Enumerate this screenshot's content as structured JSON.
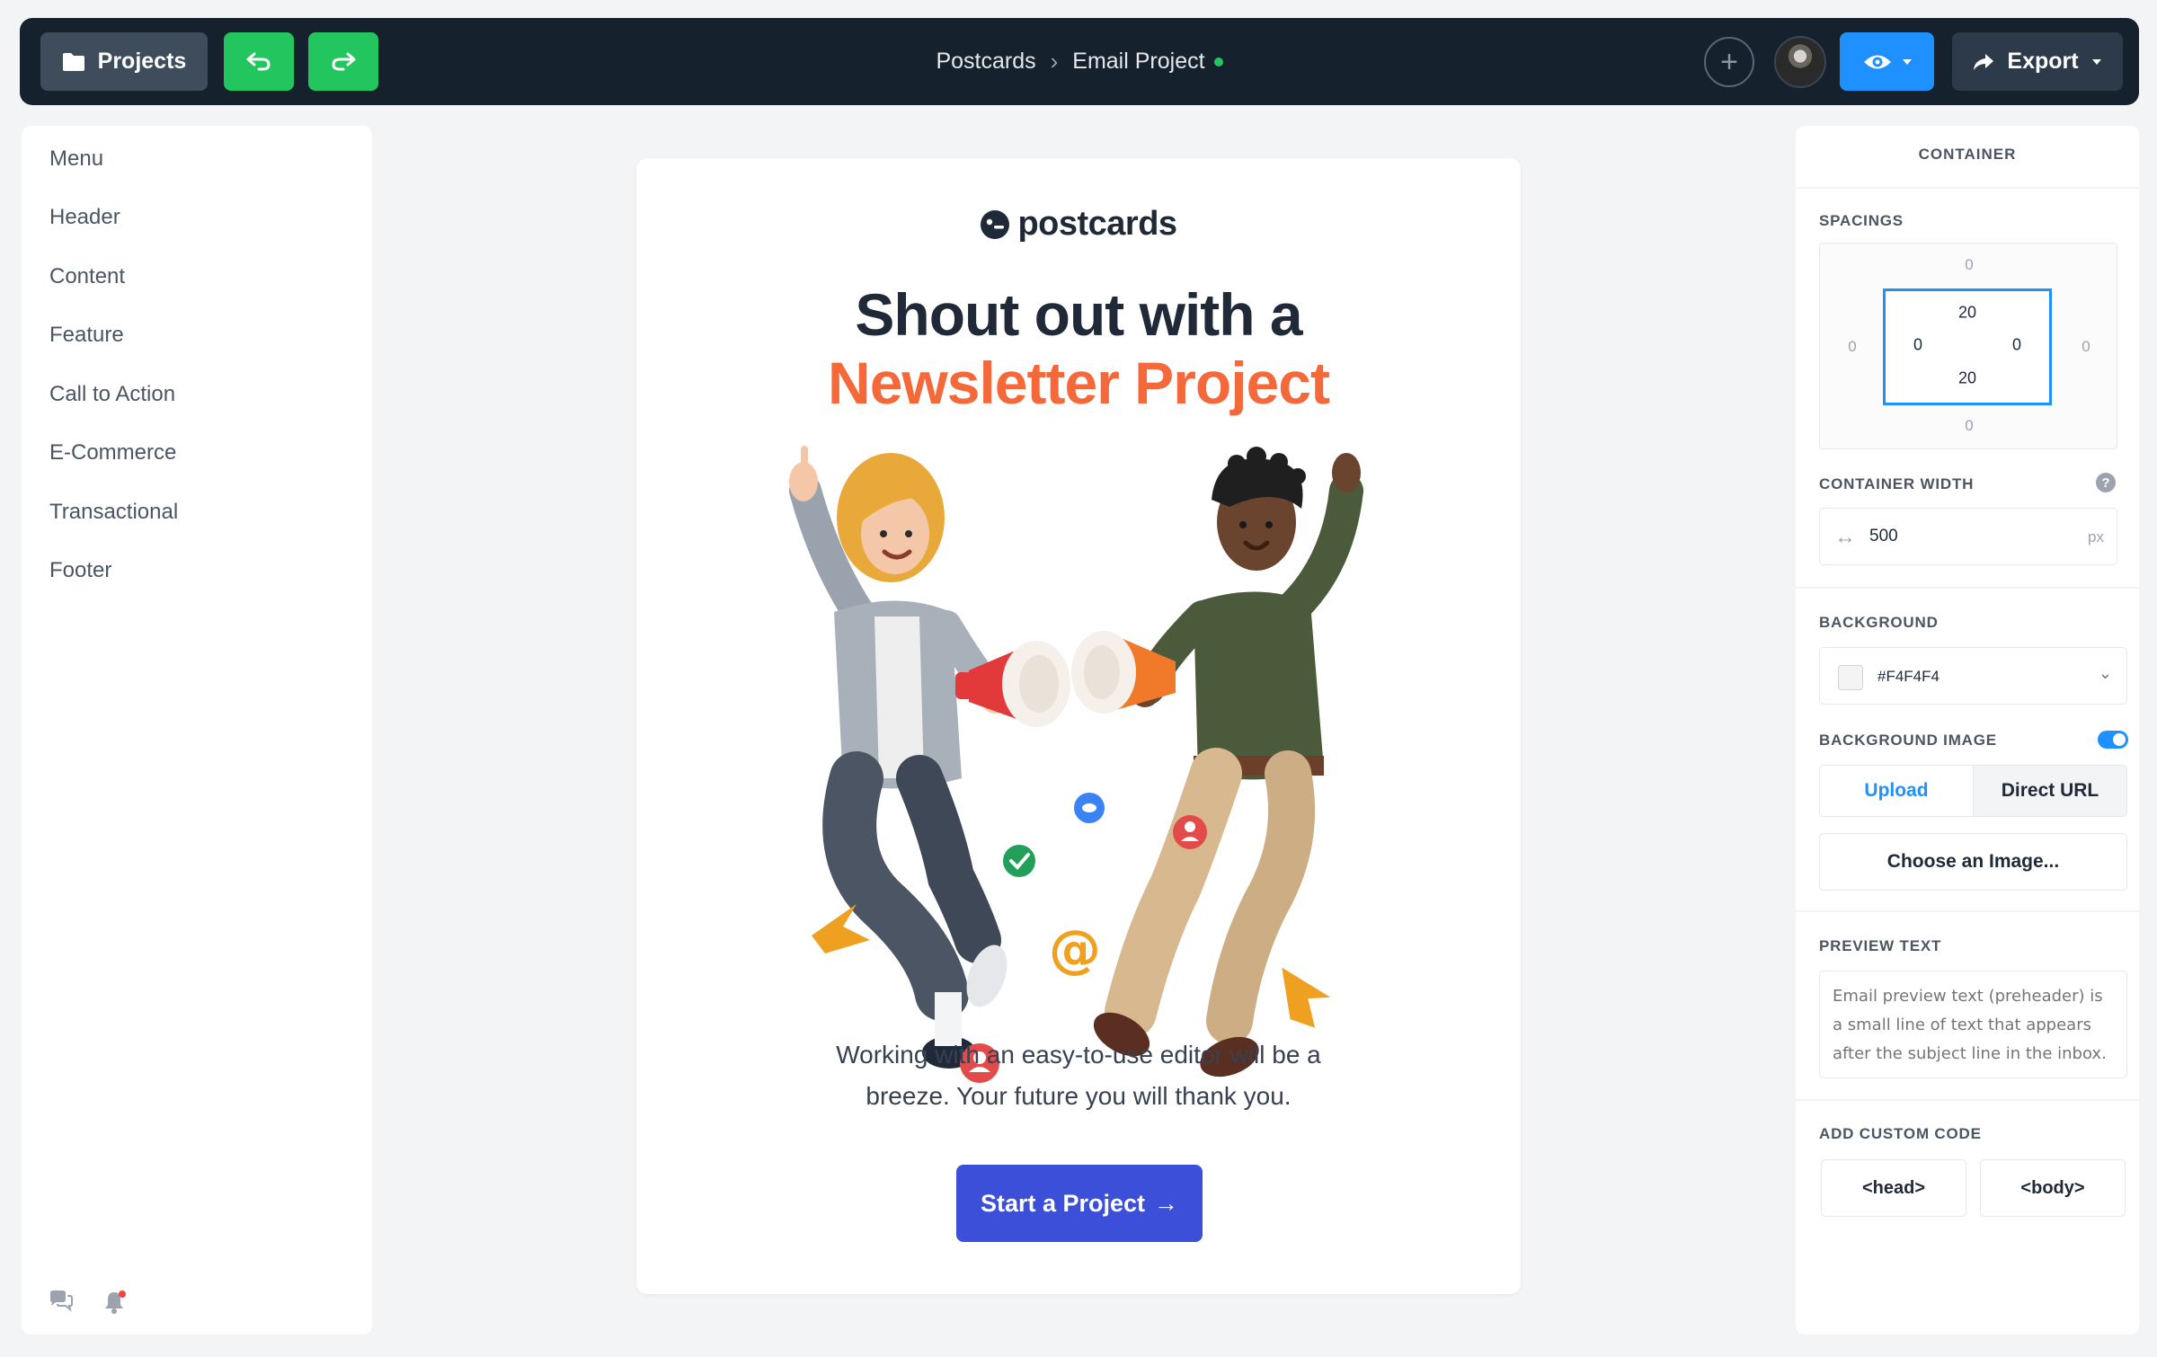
{
  "toolbar": {
    "projects_label": "Projects",
    "export_label": "Export",
    "undo_icon": "undo-icon",
    "redo_icon": "redo-icon"
  },
  "breadcrumb": {
    "root": "Postcards",
    "current": "Email Project",
    "status_color": "#22c55e"
  },
  "sidebar": {
    "items": [
      {
        "label": "Menu"
      },
      {
        "label": "Header"
      },
      {
        "label": "Content"
      },
      {
        "label": "Feature"
      },
      {
        "label": "Call to Action"
      },
      {
        "label": "E-Commerce"
      },
      {
        "label": "Transactional"
      },
      {
        "label": "Footer"
      }
    ]
  },
  "email": {
    "logo_text": "postcards",
    "headline_line1": "Shout out with a",
    "headline_line2": "Newsletter Project",
    "body_line1": "Working with an easy-to-use editor will be a",
    "body_line2": "breeze. Your future you will thank you.",
    "cta_label": "Start a Project",
    "accent_color": "#f4683a",
    "cta_color": "#3b4fd8"
  },
  "panel": {
    "title": "CONTAINER",
    "spacings_label": "SPACINGS",
    "spacing": {
      "outer": {
        "top": "0",
        "right": "0",
        "bottom": "0",
        "left": "0"
      },
      "inner": {
        "top": "20",
        "right": "0",
        "bottom": "20",
        "left": "0"
      }
    },
    "width_label": "CONTAINER WIDTH",
    "width_value": "500",
    "width_unit": "px",
    "background_label": "BACKGROUND",
    "background_value": "#F4F4F4",
    "bg_image_label": "BACKGROUND IMAGE",
    "bg_image_enabled": true,
    "upload_label": "Upload",
    "direct_url_label": "Direct URL",
    "choose_image_label": "Choose an Image...",
    "preview_text_label": "PREVIEW TEXT",
    "preview_text_placeholder": "Email preview text (preheader) is a small line of text that appears after the subject line in the inbox.",
    "custom_code_label": "ADD CUSTOM CODE",
    "head_label": "<head>",
    "body_label": "<body>"
  },
  "colors": {
    "topbar": "#16212e",
    "green_buttons": "#22c55e",
    "preview_button": "#1e90ff"
  }
}
